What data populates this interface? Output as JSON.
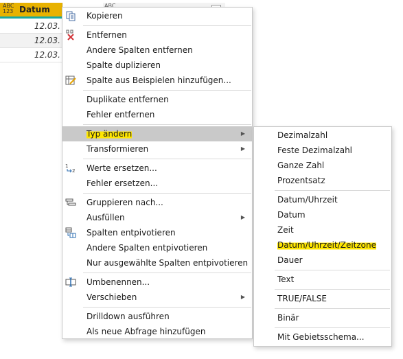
{
  "grid": {
    "column_header": "Datum",
    "type_badge_top": "ABC",
    "type_badge_bottom": "123",
    "second_type_badge": "ABC",
    "rows": [
      "12.03.",
      "12.03.",
      "12.03."
    ],
    "accent_color": "#e8b200",
    "teal_color": "#1ba8a0"
  },
  "context_menu": {
    "items": [
      {
        "label": "Kopieren",
        "icon": "copy-icon"
      },
      {
        "label": "Entfernen",
        "icon": "remove-column-icon"
      },
      {
        "label": "Andere Spalten entfernen"
      },
      {
        "label": "Spalte duplizieren"
      },
      {
        "label": "Spalte aus Beispielen hinzufügen...",
        "icon": "column-from-examples-icon"
      },
      {
        "label": "Duplikate entfernen"
      },
      {
        "label": "Fehler entfernen"
      },
      {
        "label": "Typ ändern",
        "submenu": true,
        "highlighted": true
      },
      {
        "label": "Transformieren",
        "submenu": true
      },
      {
        "label": "Werte ersetzen...",
        "icon": "replace-values-icon"
      },
      {
        "label": "Fehler ersetzen..."
      },
      {
        "label": "Gruppieren nach...",
        "icon": "group-by-icon"
      },
      {
        "label": "Ausfüllen",
        "submenu": true
      },
      {
        "label": "Spalten entpivotieren",
        "icon": "unpivot-icon"
      },
      {
        "label": "Andere Spalten entpivotieren"
      },
      {
        "label": "Nur ausgewählte Spalten entpivotieren"
      },
      {
        "label": "Umbenennen...",
        "icon": "rename-icon"
      },
      {
        "label": "Verschieben",
        "submenu": true
      },
      {
        "label": "Drilldown ausführen"
      },
      {
        "label": "Als neue Abfrage hinzufügen"
      }
    ]
  },
  "type_submenu": {
    "items": [
      "Dezimalzahl",
      "Feste Dezimalzahl",
      "Ganze Zahl",
      "Prozentsatz",
      "Datum/Uhrzeit",
      "Datum",
      "Zeit",
      "Datum/Uhrzeit/Zeitzone",
      "Dauer",
      "Text",
      "TRUE/FALSE",
      "Binär",
      "Mit Gebietsschema..."
    ],
    "highlighted_item": "Datum/Uhrzeit/Zeitzone",
    "highlight_color": "#ffe600"
  }
}
